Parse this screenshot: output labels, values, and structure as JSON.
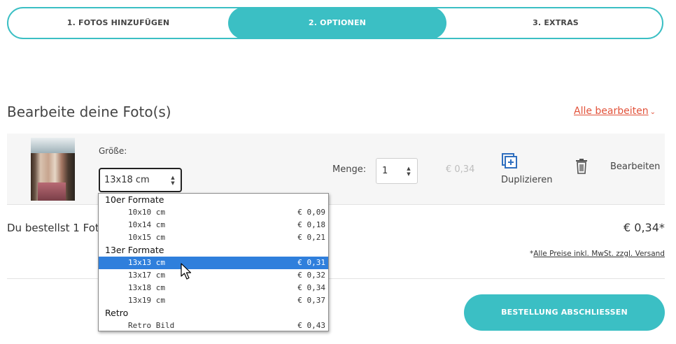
{
  "stepper": {
    "steps": [
      {
        "label": "1. FOTOS HINZUFÜGEN"
      },
      {
        "label": "2. OPTIONEN"
      },
      {
        "label": "3. EXTRAS"
      }
    ],
    "active_step": 2
  },
  "page_title": "Bearbeite deine Foto(s)",
  "edit_all_label": "Alle bearbeiten",
  "photo": {
    "size_label": "Größe:",
    "size_value": "13x18 cm",
    "quantity_label": "Menge:",
    "quantity_value": "1",
    "unit_price": "€ 0,34",
    "duplicate_label": "Duplizieren",
    "edit_label": "Bearbeiten"
  },
  "summary": {
    "text": "Du bestellst 1 Fot",
    "total": "€ 0,34*",
    "note_prefix": "*",
    "note_link": "Alle Preise inkl. MwSt. zzgl. Versand"
  },
  "order_button": "BESTELLUNG ABSCHLIESSEN",
  "size_dropdown": {
    "groups": [
      {
        "label": "10er Formate",
        "options": [
          {
            "label": "10x10 cm",
            "price": "€ 0,09"
          },
          {
            "label": "10x14 cm",
            "price": "€ 0,18"
          },
          {
            "label": "10x15 cm",
            "price": "€ 0,21"
          }
        ]
      },
      {
        "label": "13er Formate",
        "options": [
          {
            "label": "13x13 cm",
            "price": "€ 0,31",
            "selected": true
          },
          {
            "label": "13x17 cm",
            "price": "€ 0,32"
          },
          {
            "label": "13x18 cm",
            "price": "€ 0,34"
          },
          {
            "label": "13x19 cm",
            "price": "€ 0,37"
          }
        ]
      },
      {
        "label": "Retro",
        "options": [
          {
            "label": "Retro Bild",
            "price": "€ 0,43"
          }
        ]
      }
    ]
  },
  "colors": {
    "accent": "#3bbfc4",
    "link_red": "#e2523a",
    "option_highlight": "#2f7fdc",
    "icon_blue": "#2f6fbf"
  },
  "icons": [
    "duplicate-icon",
    "trash-icon",
    "chevron-down-icon",
    "updown-arrows-icon",
    "mouse-cursor-icon"
  ]
}
